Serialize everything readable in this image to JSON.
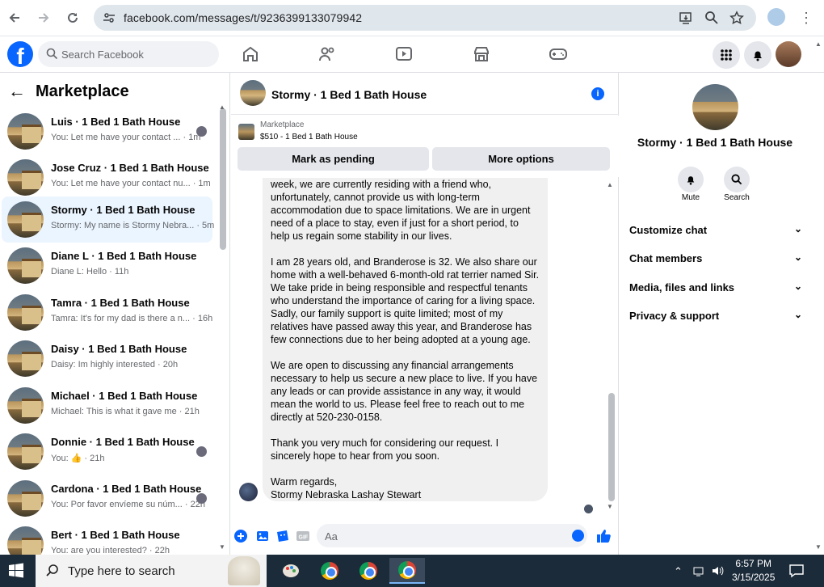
{
  "browser": {
    "url": "facebook.com/messages/t/9236399133079942",
    "back_icon": "arrow-left-icon",
    "forward_icon": "arrow-right-icon",
    "reload_icon": "reload-icon"
  },
  "fb": {
    "logo": "f",
    "search_placeholder": "Search Facebook"
  },
  "left": {
    "title": "Marketplace",
    "conversations": [
      {
        "name": "Luis · 1 Bed 1 Bath House",
        "preview": "You: Let me have your contact ... · 1m",
        "mini": true
      },
      {
        "name": "Jose Cruz · 1 Bed 1 Bath House",
        "preview": "You: Let me have your contact nu... · 1m",
        "mini": false
      },
      {
        "name": "Stormy · 1 Bed 1 Bath House",
        "preview": "Stormy: My name is Stormy Nebra... · 5m",
        "mini": false,
        "active": true
      },
      {
        "name": "Diane L · 1 Bed 1 Bath House",
        "preview": "Diane L: Hello · 11h",
        "mini": false
      },
      {
        "name": "Tamra · 1 Bed 1 Bath House",
        "preview": "Tamra: It's for my dad is there a n... · 16h",
        "mini": false
      },
      {
        "name": "Daisy · 1 Bed 1 Bath House",
        "preview": "Daisy: Im highly interested · 20h",
        "mini": false
      },
      {
        "name": "Michael · 1 Bed 1 Bath House",
        "preview": "Michael: This is what it gave me · 21h",
        "mini": false
      },
      {
        "name": "Donnie · 1 Bed 1 Bath House",
        "preview": "You: 👍 · 21h",
        "mini": true
      },
      {
        "name": "Cardona · 1 Bed 1 Bath House",
        "preview": "You: Por favor envíeme su núm... · 22h",
        "mini": true
      },
      {
        "name": "Bert · 1 Bed 1 Bath House",
        "preview": "You: are you interested? · 22h",
        "mini": false
      }
    ]
  },
  "chat": {
    "title": "Stormy · 1 Bed 1 Bath House",
    "marketplace_label": "Marketplace",
    "listing": "$510 - 1 Bed 1 Bath House",
    "mark_pending": "Mark as pending",
    "more_options": "More options",
    "paragraphs": [
      "week, we are currently residing with a friend who, unfortunately, cannot provide us with long-term accommodation due to space limitations. We are in urgent need of a place to stay, even if just for a short period, to help us regain some stability in our lives.",
      "I am 28 years old, and Branderose is 32. We also share our home with a well-behaved 6-month-old rat terrier named Sir. We take pride in being responsible and respectful tenants who understand the importance of caring for a living space. Sadly, our family support is quite limited; most of my relatives have passed away this year, and Branderose has few connections due to her being adopted at a young age.",
      "We are open to discussing any financial arrangements necessary to help us secure a new place to live. If you have any leads or can provide assistance in any way, it would mean the world to us. Please feel free to reach out to me directly at 520-230-0158.",
      "Thank you very much for considering our request. I sincerely hope to hear from you soon.",
      "Warm regards,"
    ],
    "signature": "Stormy Nebraska Lashay Stewart",
    "composer_placeholder": "Aa"
  },
  "right": {
    "name": "Stormy · 1 Bed 1 Bath House",
    "mute": "Mute",
    "search": "Search",
    "sections": [
      "Customize chat",
      "Chat members",
      "Media, files and links",
      "Privacy & support"
    ]
  },
  "taskbar": {
    "search_placeholder": "Type here to search",
    "time": "6:57 PM",
    "date": "3/15/2025"
  }
}
